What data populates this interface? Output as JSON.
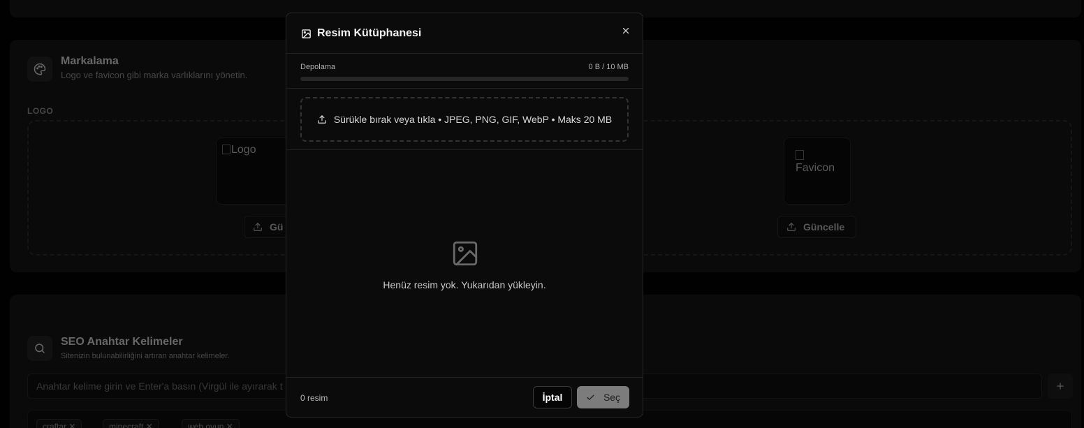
{
  "background": {
    "branding": {
      "title": "Markalama",
      "description": "Logo ve favicon gibi marka varlıklarını yönetin.",
      "logo_label": "LOGO",
      "logo_alt": "Logo",
      "favicon_alt": "Favicon",
      "update_logo_label": "Gü",
      "update_favicon_label": "Güncelle"
    },
    "seo": {
      "title": "SEO Anahtar Kelimeler",
      "description": "Sitenizin bulunabilirliğini artıran anahtar kelimeler.",
      "input_placeholder": "Anahtar kelime girin ve Enter'a basın (Virgül ile ayırarak t",
      "tags": [
        "craftar",
        "minecraft",
        "web oyun"
      ]
    }
  },
  "modal": {
    "title": "Resim Kütüphanesi",
    "storage_label": "Depolama",
    "storage_value": "0 B / 10 MB",
    "storage_fraction": 0,
    "upload_hint": "Sürükle bırak veya tıkla • JPEG, PNG, GIF, WebP • Maks 20 MB",
    "empty_message": "Henüz resim yok. Yukarıdan yükleyin.",
    "image_count": "0 resim",
    "cancel_label": "İptal",
    "select_label": "Seç"
  },
  "colors": {
    "background": "#020202",
    "card": "#141414",
    "modal": "#0b0b0b",
    "select_button": "#7c7c7c"
  }
}
